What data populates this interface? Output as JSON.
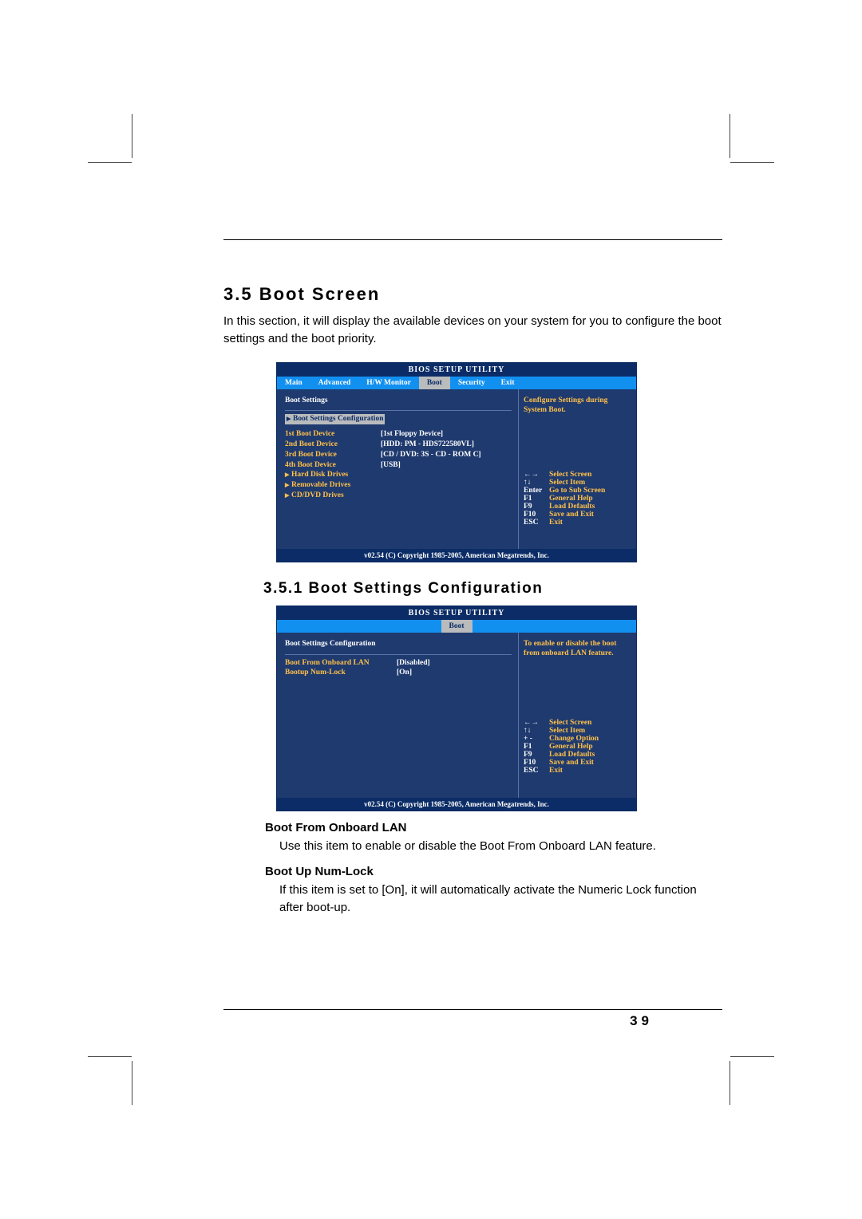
{
  "page_number": "39",
  "section_title": "3.5 Boot Screen",
  "section_body": "In this section, it will display the available devices on your system for you to configure the boot settings and the boot priority.",
  "subsection_title": "3.5.1 Boot Settings Configuration",
  "items": {
    "lan_head": "Boot From Onboard LAN",
    "lan_body": "Use this item to enable or disable the Boot From Onboard LAN feature.",
    "num_head": "Boot Up Num-Lock",
    "num_body": "If this item is set to [On], it will automatically activate the Numeric Lock function after boot-up."
  },
  "bios1": {
    "title": "BIOS SETUP UTILITY",
    "tabs": [
      "Main",
      "Advanced",
      "H/W Monitor",
      "Boot",
      "Security",
      "Exit"
    ],
    "active_tab": "Boot",
    "heading": "Boot Settings",
    "hilite": "Boot Settings Configuration",
    "rows": [
      {
        "lbl": "1st Boot Device",
        "val": "[1st Floppy Device]"
      },
      {
        "lbl": "2nd Boot Device",
        "val": "[HDD: PM - HDS722580VL]"
      },
      {
        "lbl": "3rd Boot Device",
        "val": "[CD / DVD: 3S - CD - ROM C]"
      },
      {
        "lbl": "4th Boot Device",
        "val": "[USB]"
      }
    ],
    "links": [
      "Hard Disk Drives",
      "Removable Drives",
      "CD/DVD Drives"
    ],
    "help": "Configure Settings during System Boot.",
    "keys": [
      {
        "k": "←→",
        "d": "Select Screen"
      },
      {
        "k": "↑↓",
        "d": "Select Item"
      },
      {
        "k": "Enter",
        "d": "Go to Sub Screen"
      },
      {
        "k": "F1",
        "d": "General Help"
      },
      {
        "k": "F9",
        "d": "Load Defaults"
      },
      {
        "k": "F10",
        "d": "Save and Exit"
      },
      {
        "k": "ESC",
        "d": "Exit"
      }
    ],
    "footer": "v02.54 (C) Copyright 1985-2005, American Megatrends, Inc."
  },
  "bios2": {
    "title": "BIOS SETUP UTILITY",
    "active_tab": "Boot",
    "heading": "Boot Settings Configuration",
    "rows": [
      {
        "lbl": "Boot From Onboard LAN",
        "val": "[Disabled]"
      },
      {
        "lbl": "Bootup Num-Lock",
        "val": "[On]"
      }
    ],
    "help": "To enable or disable the boot from onboard LAN feature.",
    "keys": [
      {
        "k": "←→",
        "d": "Select Screen"
      },
      {
        "k": "↑↓",
        "d": "Select Item"
      },
      {
        "k": "+ -",
        "d": "Change Option"
      },
      {
        "k": "F1",
        "d": "General Help"
      },
      {
        "k": "F9",
        "d": "Load Defaults"
      },
      {
        "k": "F10",
        "d": "Save and Exit"
      },
      {
        "k": "ESC",
        "d": "Exit"
      }
    ],
    "footer": "v02.54 (C) Copyright 1985-2005, American Megatrends, Inc."
  }
}
